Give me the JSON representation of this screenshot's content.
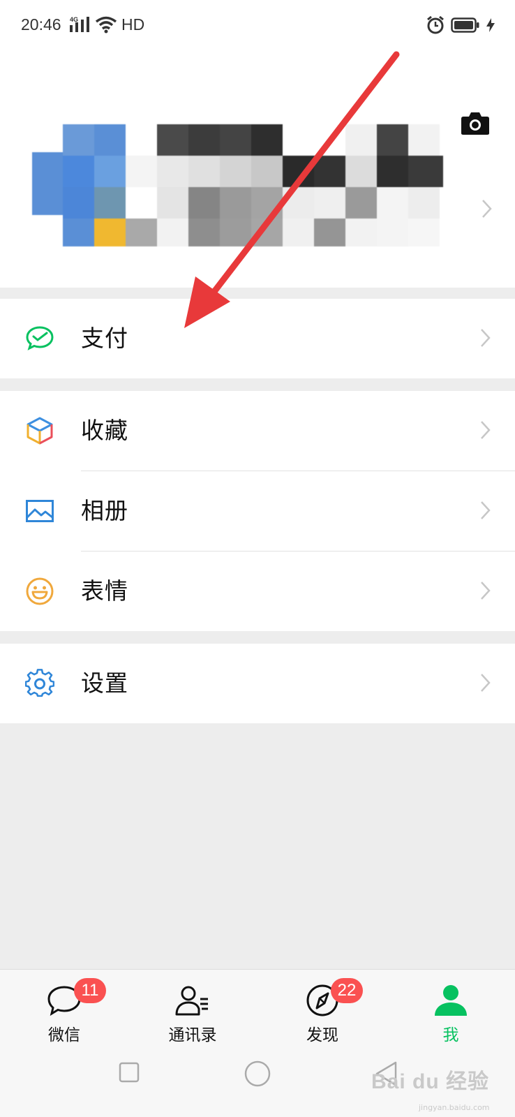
{
  "status_bar": {
    "time": "20:46",
    "network": "4G",
    "hd": "HD"
  },
  "menu": {
    "pay": {
      "label": "支付",
      "icon": "wechat-pay-icon"
    },
    "favorites": {
      "label": "收藏",
      "icon": "cube-icon"
    },
    "album": {
      "label": "相册",
      "icon": "image-icon"
    },
    "stickers": {
      "label": "表情",
      "icon": "smiley-icon"
    },
    "settings": {
      "label": "设置",
      "icon": "gear-icon"
    }
  },
  "tabs": [
    {
      "label": "微信",
      "badge": "11",
      "icon": "chat-bubble-icon"
    },
    {
      "label": "通讯录",
      "badge": "",
      "icon": "contacts-icon"
    },
    {
      "label": "发现",
      "badge": "22",
      "icon": "compass-icon"
    },
    {
      "label": "我",
      "badge": "",
      "icon": "person-icon",
      "active": true
    }
  ],
  "colors": {
    "accent": "#07c160",
    "badge": "#fa5151",
    "annotation_arrow": "#e8393a"
  },
  "watermark": {
    "brand": "Bai du 经验",
    "url": "jingyan.baidu.com"
  }
}
